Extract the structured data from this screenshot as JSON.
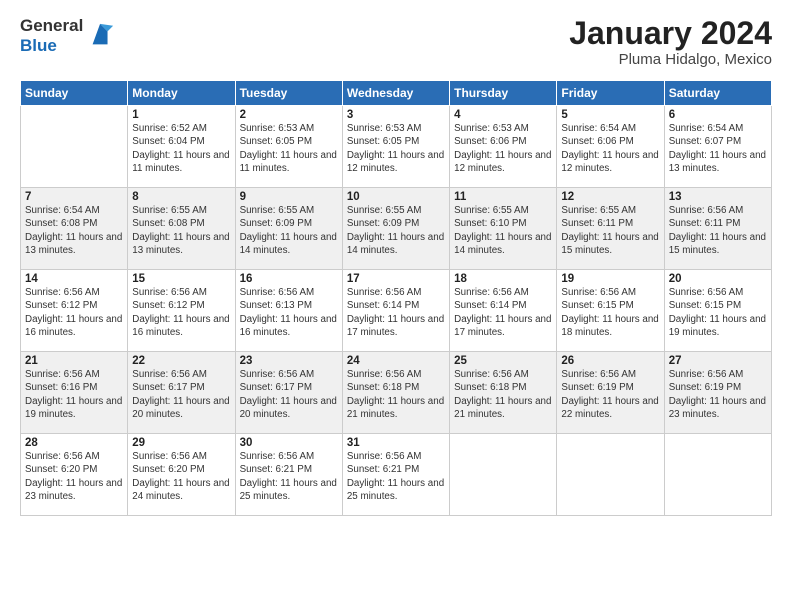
{
  "logo": {
    "general": "General",
    "blue": "Blue"
  },
  "title": "January 2024",
  "subtitle": "Pluma Hidalgo, Mexico",
  "days_of_week": [
    "Sunday",
    "Monday",
    "Tuesday",
    "Wednesday",
    "Thursday",
    "Friday",
    "Saturday"
  ],
  "weeks": [
    [
      {
        "day": "",
        "sunrise": "",
        "sunset": "",
        "daylight": ""
      },
      {
        "day": "1",
        "sunrise": "Sunrise: 6:52 AM",
        "sunset": "Sunset: 6:04 PM",
        "daylight": "Daylight: 11 hours and 11 minutes."
      },
      {
        "day": "2",
        "sunrise": "Sunrise: 6:53 AM",
        "sunset": "Sunset: 6:05 PM",
        "daylight": "Daylight: 11 hours and 11 minutes."
      },
      {
        "day": "3",
        "sunrise": "Sunrise: 6:53 AM",
        "sunset": "Sunset: 6:05 PM",
        "daylight": "Daylight: 11 hours and 12 minutes."
      },
      {
        "day": "4",
        "sunrise": "Sunrise: 6:53 AM",
        "sunset": "Sunset: 6:06 PM",
        "daylight": "Daylight: 11 hours and 12 minutes."
      },
      {
        "day": "5",
        "sunrise": "Sunrise: 6:54 AM",
        "sunset": "Sunset: 6:06 PM",
        "daylight": "Daylight: 11 hours and 12 minutes."
      },
      {
        "day": "6",
        "sunrise": "Sunrise: 6:54 AM",
        "sunset": "Sunset: 6:07 PM",
        "daylight": "Daylight: 11 hours and 13 minutes."
      }
    ],
    [
      {
        "day": "7",
        "sunrise": "Sunrise: 6:54 AM",
        "sunset": "Sunset: 6:08 PM",
        "daylight": "Daylight: 11 hours and 13 minutes."
      },
      {
        "day": "8",
        "sunrise": "Sunrise: 6:55 AM",
        "sunset": "Sunset: 6:08 PM",
        "daylight": "Daylight: 11 hours and 13 minutes."
      },
      {
        "day": "9",
        "sunrise": "Sunrise: 6:55 AM",
        "sunset": "Sunset: 6:09 PM",
        "daylight": "Daylight: 11 hours and 14 minutes."
      },
      {
        "day": "10",
        "sunrise": "Sunrise: 6:55 AM",
        "sunset": "Sunset: 6:09 PM",
        "daylight": "Daylight: 11 hours and 14 minutes."
      },
      {
        "day": "11",
        "sunrise": "Sunrise: 6:55 AM",
        "sunset": "Sunset: 6:10 PM",
        "daylight": "Daylight: 11 hours and 14 minutes."
      },
      {
        "day": "12",
        "sunrise": "Sunrise: 6:55 AM",
        "sunset": "Sunset: 6:11 PM",
        "daylight": "Daylight: 11 hours and 15 minutes."
      },
      {
        "day": "13",
        "sunrise": "Sunrise: 6:56 AM",
        "sunset": "Sunset: 6:11 PM",
        "daylight": "Daylight: 11 hours and 15 minutes."
      }
    ],
    [
      {
        "day": "14",
        "sunrise": "Sunrise: 6:56 AM",
        "sunset": "Sunset: 6:12 PM",
        "daylight": "Daylight: 11 hours and 16 minutes."
      },
      {
        "day": "15",
        "sunrise": "Sunrise: 6:56 AM",
        "sunset": "Sunset: 6:12 PM",
        "daylight": "Daylight: 11 hours and 16 minutes."
      },
      {
        "day": "16",
        "sunrise": "Sunrise: 6:56 AM",
        "sunset": "Sunset: 6:13 PM",
        "daylight": "Daylight: 11 hours and 16 minutes."
      },
      {
        "day": "17",
        "sunrise": "Sunrise: 6:56 AM",
        "sunset": "Sunset: 6:14 PM",
        "daylight": "Daylight: 11 hours and 17 minutes."
      },
      {
        "day": "18",
        "sunrise": "Sunrise: 6:56 AM",
        "sunset": "Sunset: 6:14 PM",
        "daylight": "Daylight: 11 hours and 17 minutes."
      },
      {
        "day": "19",
        "sunrise": "Sunrise: 6:56 AM",
        "sunset": "Sunset: 6:15 PM",
        "daylight": "Daylight: 11 hours and 18 minutes."
      },
      {
        "day": "20",
        "sunrise": "Sunrise: 6:56 AM",
        "sunset": "Sunset: 6:15 PM",
        "daylight": "Daylight: 11 hours and 19 minutes."
      }
    ],
    [
      {
        "day": "21",
        "sunrise": "Sunrise: 6:56 AM",
        "sunset": "Sunset: 6:16 PM",
        "daylight": "Daylight: 11 hours and 19 minutes."
      },
      {
        "day": "22",
        "sunrise": "Sunrise: 6:56 AM",
        "sunset": "Sunset: 6:17 PM",
        "daylight": "Daylight: 11 hours and 20 minutes."
      },
      {
        "day": "23",
        "sunrise": "Sunrise: 6:56 AM",
        "sunset": "Sunset: 6:17 PM",
        "daylight": "Daylight: 11 hours and 20 minutes."
      },
      {
        "day": "24",
        "sunrise": "Sunrise: 6:56 AM",
        "sunset": "Sunset: 6:18 PM",
        "daylight": "Daylight: 11 hours and 21 minutes."
      },
      {
        "day": "25",
        "sunrise": "Sunrise: 6:56 AM",
        "sunset": "Sunset: 6:18 PM",
        "daylight": "Daylight: 11 hours and 21 minutes."
      },
      {
        "day": "26",
        "sunrise": "Sunrise: 6:56 AM",
        "sunset": "Sunset: 6:19 PM",
        "daylight": "Daylight: 11 hours and 22 minutes."
      },
      {
        "day": "27",
        "sunrise": "Sunrise: 6:56 AM",
        "sunset": "Sunset: 6:19 PM",
        "daylight": "Daylight: 11 hours and 23 minutes."
      }
    ],
    [
      {
        "day": "28",
        "sunrise": "Sunrise: 6:56 AM",
        "sunset": "Sunset: 6:20 PM",
        "daylight": "Daylight: 11 hours and 23 minutes."
      },
      {
        "day": "29",
        "sunrise": "Sunrise: 6:56 AM",
        "sunset": "Sunset: 6:20 PM",
        "daylight": "Daylight: 11 hours and 24 minutes."
      },
      {
        "day": "30",
        "sunrise": "Sunrise: 6:56 AM",
        "sunset": "Sunset: 6:21 PM",
        "daylight": "Daylight: 11 hours and 25 minutes."
      },
      {
        "day": "31",
        "sunrise": "Sunrise: 6:56 AM",
        "sunset": "Sunset: 6:21 PM",
        "daylight": "Daylight: 11 hours and 25 minutes."
      },
      {
        "day": "",
        "sunrise": "",
        "sunset": "",
        "daylight": ""
      },
      {
        "day": "",
        "sunrise": "",
        "sunset": "",
        "daylight": ""
      },
      {
        "day": "",
        "sunrise": "",
        "sunset": "",
        "daylight": ""
      }
    ]
  ]
}
